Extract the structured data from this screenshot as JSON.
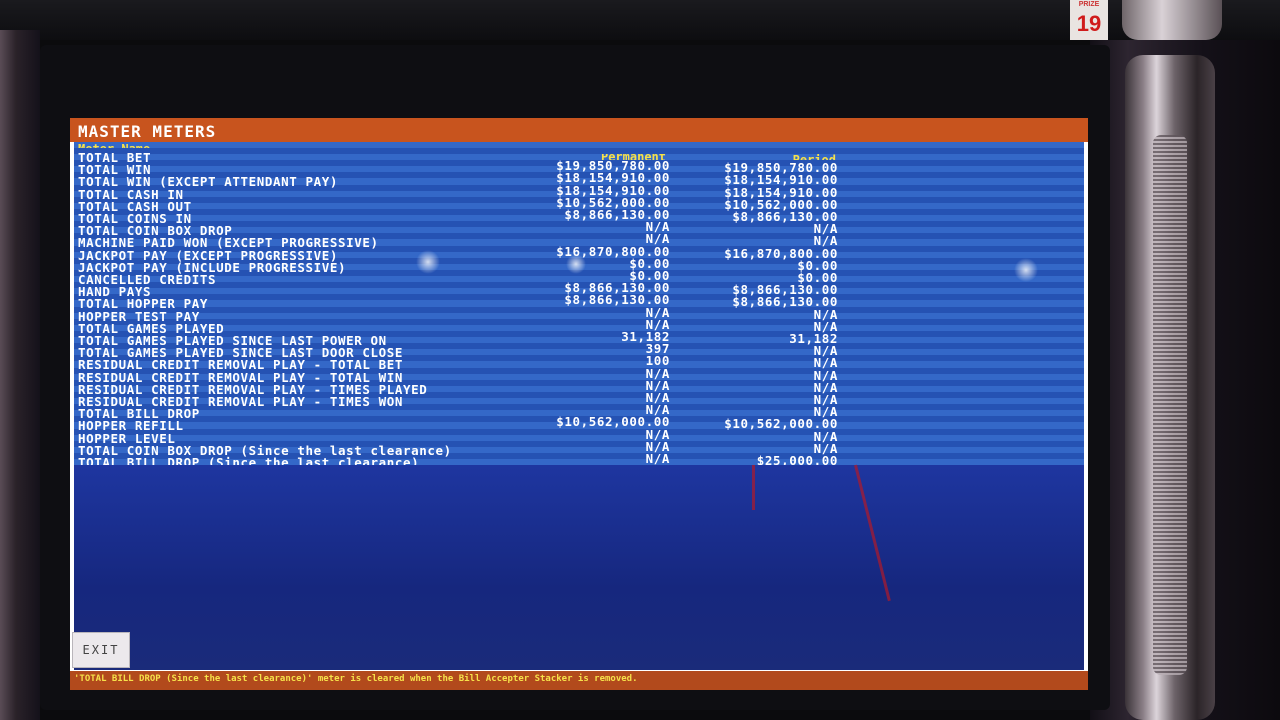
{
  "tag": {
    "top": "PRIZE",
    "number": "19"
  },
  "screen": {
    "title": "MASTER METERS",
    "columns": {
      "name": "Meter Name",
      "permanent": "Permanent",
      "period": "Period"
    },
    "rows": [
      {
        "name": "TOTAL BET",
        "permanent": "",
        "period": ""
      },
      {
        "name": "TOTAL WIN",
        "permanent": "$19,850,780.00",
        "period": "$19,850,780.00"
      },
      {
        "name": "TOTAL WIN (EXCEPT ATTENDANT PAY)",
        "permanent": "$18,154,910.00",
        "period": "$18,154,910.00"
      },
      {
        "name": "TOTAL CASH IN",
        "permanent": "$18,154,910.00",
        "period": "$18,154,910.00"
      },
      {
        "name": "TOTAL CASH OUT",
        "permanent": "$10,562,000.00",
        "period": "$10,562,000.00"
      },
      {
        "name": "TOTAL COINS IN",
        "permanent": "$8,866,130.00",
        "period": "$8,866,130.00"
      },
      {
        "name": "TOTAL COIN BOX DROP",
        "permanent": "N/A",
        "period": "N/A"
      },
      {
        "name": "MACHINE PAID WON (EXCEPT PROGRESSIVE)",
        "permanent": "N/A",
        "period": "N/A"
      },
      {
        "name": "JACKPOT PAY (EXCEPT PROGRESSIVE)",
        "permanent": "$16,870,800.00",
        "period": "$16,870,800.00"
      },
      {
        "name": "JACKPOT PAY (INCLUDE PROGRESSIVE)",
        "permanent": "$0.00",
        "period": "$0.00"
      },
      {
        "name": "CANCELLED CREDITS",
        "permanent": "$0.00",
        "period": "$0.00"
      },
      {
        "name": "HAND PAYS",
        "permanent": "$8,866,130.00",
        "period": "$8,866,130.00"
      },
      {
        "name": "TOTAL HOPPER PAY",
        "permanent": "$8,866,130.00",
        "period": "$8,866,130.00"
      },
      {
        "name": "HOPPER TEST PAY",
        "permanent": "N/A",
        "period": "N/A"
      },
      {
        "name": "TOTAL GAMES PLAYED",
        "permanent": "N/A",
        "period": "N/A"
      },
      {
        "name": "TOTAL GAMES PLAYED SINCE LAST POWER ON",
        "permanent": "31,182",
        "period": "31,182"
      },
      {
        "name": "TOTAL GAMES PLAYED SINCE LAST DOOR CLOSE",
        "permanent": "397",
        "period": "N/A"
      },
      {
        "name": "RESIDUAL CREDIT REMOVAL PLAY - TOTAL BET",
        "permanent": "100",
        "period": "N/A"
      },
      {
        "name": "RESIDUAL CREDIT REMOVAL PLAY - TOTAL WIN",
        "permanent": "N/A",
        "period": "N/A"
      },
      {
        "name": "RESIDUAL CREDIT REMOVAL PLAY - TIMES PLAYED",
        "permanent": "N/A",
        "period": "N/A"
      },
      {
        "name": "RESIDUAL CREDIT REMOVAL PLAY - TIMES WON",
        "permanent": "N/A",
        "period": "N/A"
      },
      {
        "name": "TOTAL BILL DROP",
        "permanent": "N/A",
        "period": "N/A"
      },
      {
        "name": "HOPPER REFILL",
        "permanent": "$10,562,000.00",
        "period": "$10,562,000.00"
      },
      {
        "name": "HOPPER LEVEL",
        "permanent": "N/A",
        "period": "N/A"
      },
      {
        "name": "TOTAL COIN BOX DROP (Since the last clearance)",
        "permanent": "N/A",
        "period": "N/A"
      },
      {
        "name": "TOTAL BILL DROP (Since the last clearance)",
        "permanent": "N/A",
        "period": "$25,000.00"
      }
    ],
    "exit_label": "EXIT",
    "footer": "'TOTAL BILL DROP (Since the last clearance)' meter is cleared when the Bill Accepter Stacker is removed."
  },
  "colors": {
    "title_bar": "#c8541e",
    "meter_bg": "#3468c8",
    "header_text": "#f6e14a",
    "footer_bar": "#b24a1c"
  }
}
